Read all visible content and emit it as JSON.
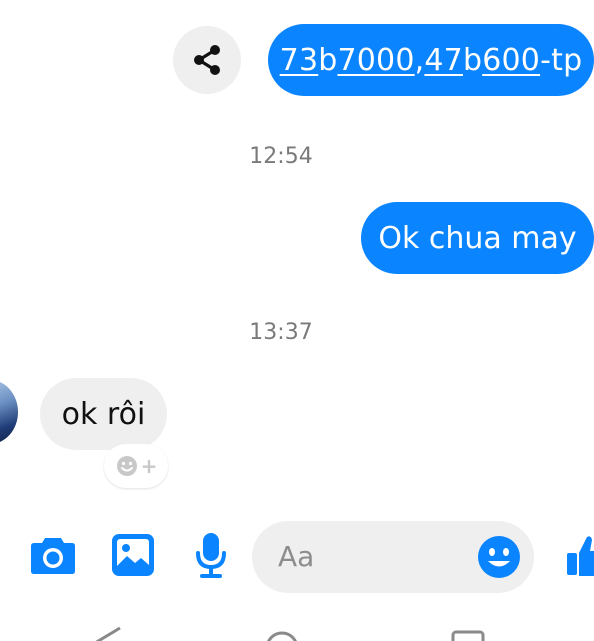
{
  "colors": {
    "accent": "#0a84ff",
    "incoming_bubble": "#efefef",
    "timestamp": "#7a7a7a"
  },
  "messages": [
    {
      "type": "outgoing",
      "text_parts": [
        {
          "text": "73",
          "link": true
        },
        {
          "text": "b",
          "link": false
        },
        {
          "text": "7000",
          "link": true
        },
        {
          "text": ",",
          "link": false
        },
        {
          "text": "47",
          "link": true
        },
        {
          "text": "b",
          "link": false
        },
        {
          "text": "600",
          "link": true
        },
        {
          "text": "-tp",
          "link": false
        }
      ],
      "action_icon": "share-icon"
    },
    {
      "type": "timestamp",
      "text": "12:54"
    },
    {
      "type": "outgoing",
      "text": "Ok chua may"
    },
    {
      "type": "timestamp",
      "text": "13:37"
    },
    {
      "type": "incoming",
      "text": "ok rôi",
      "reaction_icon": "add-reaction-icon"
    }
  ],
  "composer": {
    "placeholder": "Aa",
    "icons": [
      "camera-icon",
      "image-icon",
      "microphone-icon",
      "emoji-icon",
      "thumbs-up-icon"
    ]
  },
  "system_nav": {
    "icons": [
      "back-icon",
      "home-icon",
      "recents-icon"
    ]
  }
}
